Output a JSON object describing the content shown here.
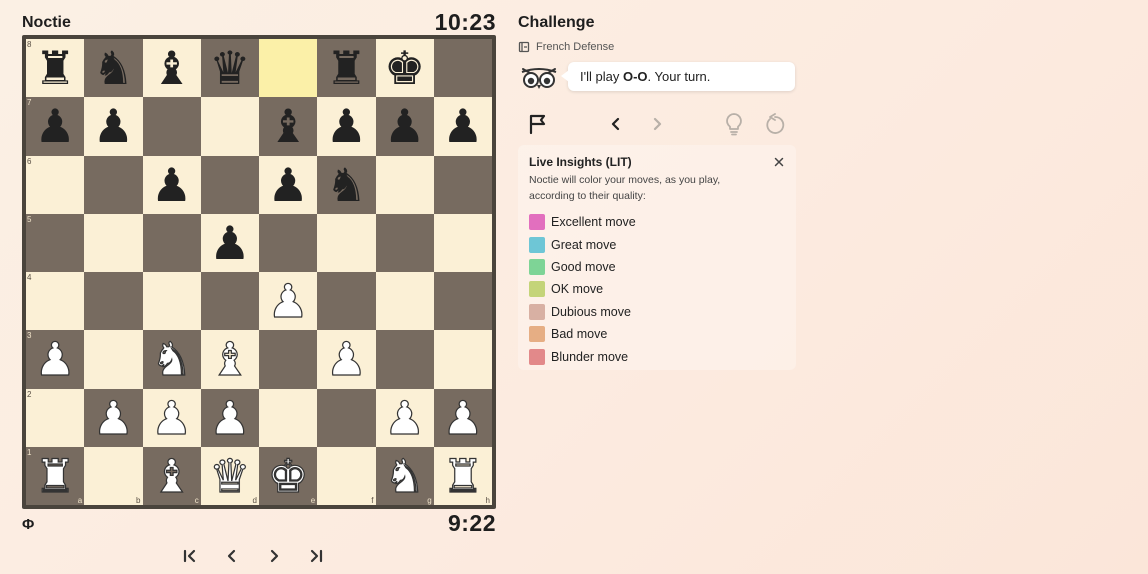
{
  "players": {
    "top": {
      "name": "Noctie",
      "clock": "10:23"
    },
    "bottom": {
      "icon_text": "Φ",
      "clock": "9:22"
    }
  },
  "board": {
    "files": [
      "a",
      "b",
      "c",
      "d",
      "e",
      "f",
      "g",
      "h"
    ],
    "ranks": [
      "8",
      "7",
      "6",
      "5",
      "4",
      "3",
      "2",
      "1"
    ],
    "highlight_squares": [
      "e8"
    ],
    "pieces": {
      "a8": "bR",
      "b8": "bN",
      "c8": "bB",
      "d8": "bQ",
      "f8": "bR",
      "g8": "bK",
      "a7": "bP",
      "b7": "bP",
      "e7": "bB",
      "f7": "bP",
      "g7": "bP",
      "h7": "bP",
      "c6": "bP",
      "e6": "bP",
      "f6": "bN",
      "d5": "bP",
      "e4": "wP",
      "a3": "wP",
      "c3": "wN",
      "d3": "wB",
      "f3": "wP",
      "b2": "wP",
      "c2": "wP",
      "d2": "wP",
      "g2": "wP",
      "h2": "wP",
      "a1": "wR",
      "c1": "wB",
      "d1": "wQ",
      "e1": "wK",
      "g1": "wN",
      "h1": "wR"
    }
  },
  "panel": {
    "title": "Challenge",
    "opening": "French Defense",
    "coach_message_prefix": "I'll play ",
    "coach_message_move": "O-O",
    "coach_message_suffix": ". Your turn.",
    "insights": {
      "title": "Live Insights (LIT)",
      "description": "Noctie will color your moves, as you play, according to their quality:",
      "legend": [
        {
          "label": "Excellent move",
          "color": "#e26fbe"
        },
        {
          "label": "Great move",
          "color": "#6ec6d6"
        },
        {
          "label": "Good move",
          "color": "#7ed496"
        },
        {
          "label": "OK move",
          "color": "#c4d479"
        },
        {
          "label": "Dubious move",
          "color": "#d8b0a3"
        },
        {
          "label": "Bad move",
          "color": "#e6ae84"
        },
        {
          "label": "Blunder move",
          "color": "#e2898a"
        }
      ]
    }
  },
  "icons": {
    "nav": [
      "first-icon",
      "previous-icon",
      "next-icon",
      "last-icon"
    ],
    "tools": [
      "resign-flag-icon",
      "undo-back-icon",
      "forward-icon",
      "hint-bulb-icon",
      "takeback-icon"
    ]
  }
}
